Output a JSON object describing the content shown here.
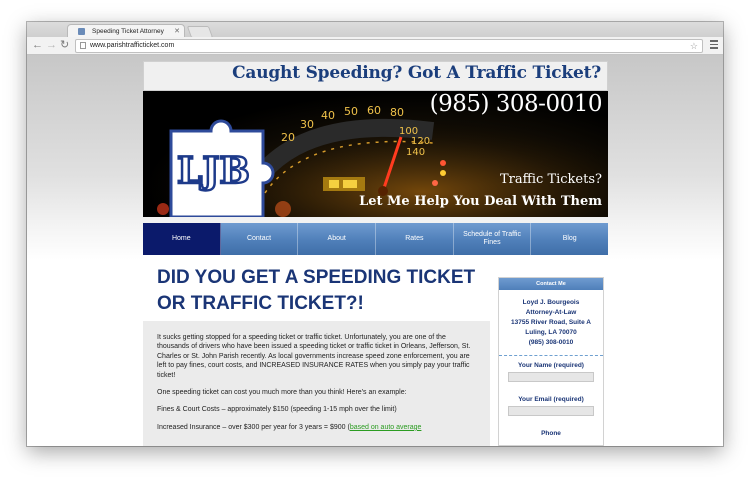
{
  "browser": {
    "tab_title": "Speeding Ticket Attorney",
    "tab_close": "✕",
    "url": "www.parishtrafficticket.com",
    "back_glyph": "←",
    "forward_glyph": "→",
    "reload_glyph": "↻",
    "star_glyph": "☆",
    "icons": [
      "back-icon",
      "forward-icon",
      "reload-icon",
      "page-icon",
      "star-icon",
      "menu-icon"
    ]
  },
  "header": {
    "headline": "Caught Speeding? Got A Traffic Ticket?",
    "logo": "LJB",
    "phone": "(985) 308-0010",
    "tagline1": "Traffic Tickets?",
    "tagline2": "Let Me Help You Deal With Them"
  },
  "nav": {
    "items": [
      {
        "label": "Home"
      },
      {
        "label": "Contact"
      },
      {
        "label": "About"
      },
      {
        "label": "Rates"
      },
      {
        "label": "Schedule of Traffic Fines"
      },
      {
        "label": "Blog"
      }
    ],
    "active_index": 0
  },
  "main": {
    "title": "DID YOU GET A SPEEDING TICKET OR TRAFFIC TICKET?!",
    "para1": "It sucks getting stopped for a speeding ticket or traffic ticket. Unfortunately, you are one of the thousands of drivers who have been issued a speeding ticket or traffic ticket in Orleans, Jefferson, St. Charles or St. John Parish recently.  As local governments increase speed zone enforcement, you are left to pay fines, court costs, and INCREASED INSURANCE RATES when you simply pay your traffic ticket!",
    "para2": "One speeding ticket can cost you much more than you think!  Here's an example:",
    "para3": "Fines & Court Costs – approximately $150 (speeding 1-15 mph over the limit)",
    "para4_text": "Increased Insurance – over $300 per year for 3 years = $900 (",
    "para4_link": "based on auto average"
  },
  "sidebar": {
    "heading": "Contact Me",
    "name": "Loyd J. Bourgeois",
    "role": "Attorney-At-Law",
    "street": "13755 River Road, Suite A",
    "city": "Luling, LA 70070",
    "phone": "(985) 308-0010",
    "field1_label": "Your Name (required)",
    "field2_label": "Your Email (required)",
    "field3_label": "Phone"
  },
  "colors": {
    "brand_blue": "#1a3576",
    "nav_active": "#0b1a6b",
    "link_green": "#2b9c21"
  }
}
